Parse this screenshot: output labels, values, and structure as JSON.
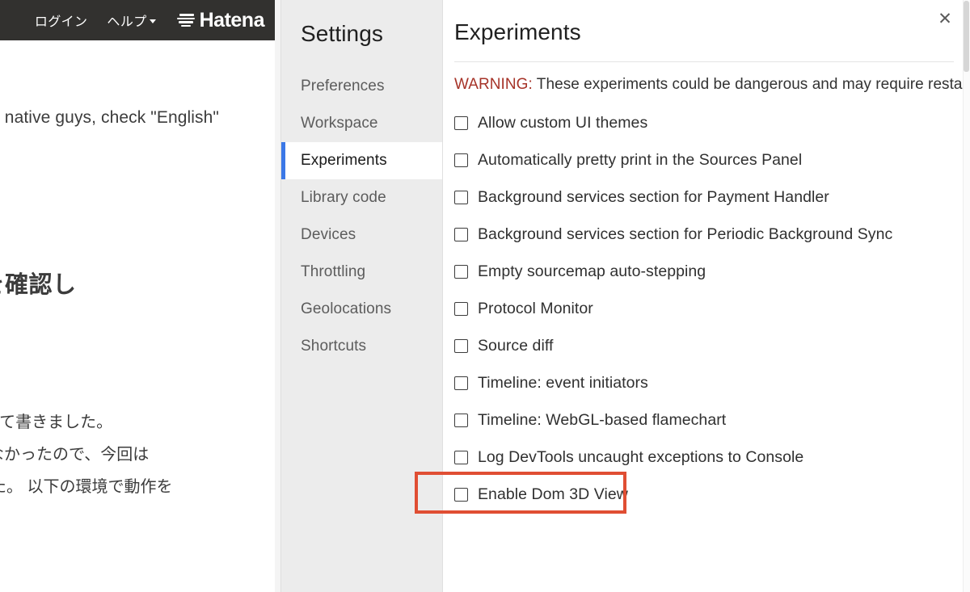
{
  "background_page": {
    "header": {
      "login_label": "ログイン",
      "help_label": "ヘルプ",
      "brand_label": "Hatena",
      "brand_icon": "hatena-logo-icon",
      "caret_icon": "chevron-down-icon"
    },
    "text_lines": {
      "line_en": "Japanese native guys, check \"English\"",
      "heading": "ドの概要と動作を確認し",
      "body_1": "meについて書きました。",
      "body_2": "ロードの話がなかったので、今回は",
      "body_3": "書きました。 以下の環境で動作を"
    }
  },
  "settings": {
    "title": "Settings",
    "nav_items": [
      {
        "label": "Preferences",
        "active": false
      },
      {
        "label": "Workspace",
        "active": false
      },
      {
        "label": "Experiments",
        "active": true
      },
      {
        "label": "Library code",
        "active": false
      },
      {
        "label": "Devices",
        "active": false
      },
      {
        "label": "Throttling",
        "active": false
      },
      {
        "label": "Geolocations",
        "active": false
      },
      {
        "label": "Shortcuts",
        "active": false
      }
    ],
    "close_icon": "close-icon",
    "close_glyph": "✕",
    "panel": {
      "heading": "Experiments",
      "warning_label": "WARNING:",
      "warning_text": " These experiments could be dangerous and may require restart",
      "experiments": [
        {
          "label": "Allow custom UI themes",
          "checked": false,
          "highlighted": false
        },
        {
          "label": "Automatically pretty print in the Sources Panel",
          "checked": false,
          "highlighted": false
        },
        {
          "label": "Background services section for Payment Handler",
          "checked": false,
          "highlighted": false
        },
        {
          "label": "Background services section for Periodic Background Sync",
          "checked": false,
          "highlighted": false
        },
        {
          "label": "Empty sourcemap auto-stepping",
          "checked": false,
          "highlighted": false
        },
        {
          "label": "Protocol Monitor",
          "checked": false,
          "highlighted": false
        },
        {
          "label": "Source diff",
          "checked": false,
          "highlighted": false
        },
        {
          "label": "Timeline: event initiators",
          "checked": false,
          "highlighted": false
        },
        {
          "label": "Timeline: WebGL-based flamechart",
          "checked": false,
          "highlighted": false
        },
        {
          "label": "Log DevTools uncaught exceptions to Console",
          "checked": false,
          "highlighted": false
        },
        {
          "label": "Enable Dom 3D View",
          "checked": false,
          "highlighted": true
        }
      ]
    }
  },
  "colors": {
    "accent_blue": "#3b78e7",
    "warning_red": "#a63328",
    "annotation_red": "#e04e33",
    "nav_background": "#ececec",
    "header_dark": "#32312f"
  }
}
